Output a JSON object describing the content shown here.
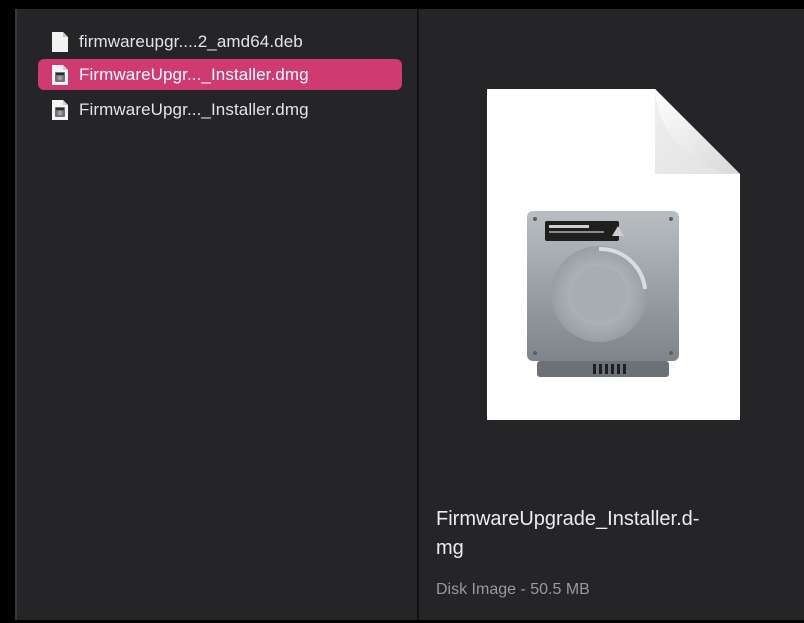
{
  "file_list": {
    "items": [
      {
        "name": "firmwareupgr....2_amd64.deb",
        "icon": "document-icon",
        "selected": false
      },
      {
        "name": "FirmwareUpgr..._Installer.dmg",
        "icon": "disk-image-file-icon",
        "selected": true
      },
      {
        "name": "FirmwareUpgr..._Installer.dmg",
        "icon": "disk-image-file-icon",
        "selected": false
      }
    ]
  },
  "preview": {
    "icon": "disk-image-document-icon",
    "filename_display": "FirmwareUpgrade_Installer.d-\nmg",
    "meta": "Disk Image - 50.5 MB"
  },
  "colors": {
    "background": "#252528",
    "selection": "#cf3a70",
    "text_primary": "#ececee",
    "text_secondary": "#9a9a9e"
  }
}
